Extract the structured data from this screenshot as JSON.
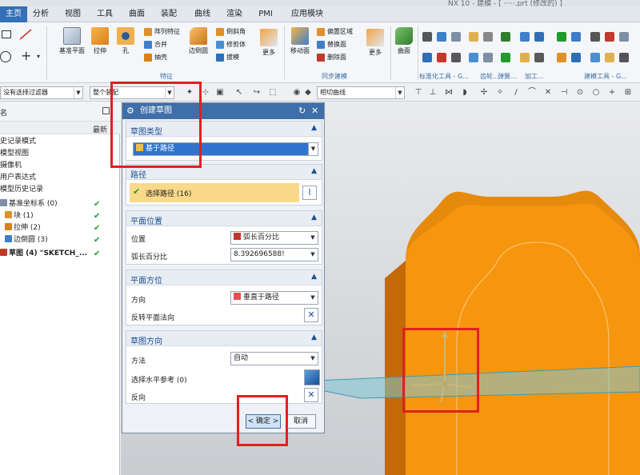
{
  "window": {
    "title_fragment": "NX 10 - 建模 - [ ·····.prt (修改的) ]"
  },
  "menu_tabs": [
    "主页",
    "分析",
    "视图",
    "工具",
    "曲面",
    "装配",
    "曲线",
    "渲染",
    "PMI",
    "应用模块"
  ],
  "ribbon": {
    "big_buttons": {
      "datum_plane": "基准平面",
      "extrude": "拉伸",
      "hole": "孔",
      "edge_blend": "边倒圆",
      "more1": "更多",
      "move_face": "移动面",
      "more2": "更多",
      "surface": "曲面"
    },
    "small_buttons": {
      "pattern_feature": "阵列特征",
      "unite": "合并",
      "shell": "抽壳",
      "chamfer": "倒斜角",
      "trim_body": "修剪体",
      "draft": "拔模",
      "offset_region": "偏置区域",
      "replace_face": "替换面",
      "delete_face": "删除面"
    },
    "groups": {
      "feature": "特征",
      "sync": "同步建模",
      "std_tools": "标准化工具 - G...",
      "gear": "齿轮...",
      "spring": "弹簧...",
      "machining": "加工...",
      "build_tools": "建模工具 - G..."
    }
  },
  "filter_bar": {
    "filter": "没有选择过滤器",
    "scope": "整个装配",
    "curve_rule": "相切曲线"
  },
  "navigator": {
    "header": "名",
    "col_latest": "最新",
    "rows": [
      {
        "label": "史记录模式",
        "check": ""
      },
      {
        "label": "模型视图",
        "check": ""
      },
      {
        "label": "摄像机",
        "check": ""
      },
      {
        "label": "用户表达式",
        "check": ""
      },
      {
        "label": "模型历史记录",
        "check": ""
      },
      {
        "label": "基准坐标系 (0)",
        "check": "✔"
      },
      {
        "label": "块 (1)",
        "check": "✔"
      },
      {
        "label": "拉伸 (2)",
        "check": "✔"
      },
      {
        "label": "边倒圆 (3)",
        "check": "✔"
      },
      {
        "label": "草图 (4) \"SKETCH_...",
        "check": "✔"
      }
    ]
  },
  "dialog": {
    "title": "创建草图",
    "sketch_type": {
      "title": "草图类型",
      "value": "基于路径"
    },
    "path": {
      "title": "路径",
      "select_label": "选择路径 (16)"
    },
    "plane_location": {
      "title": "平面位置",
      "position_label": "位置",
      "position_value": "弧长百分比",
      "arc_pct_label": "弧长百分比",
      "arc_pct_value": "8.392696588!"
    },
    "plane_orientation": {
      "title": "平面方位",
      "direction_label": "方向",
      "direction_value": "垂直于路径",
      "reverse_label": "反转平面法向"
    },
    "sketch_orientation": {
      "title": "草图方向",
      "method_label": "方法",
      "method_value": "自动",
      "horiz_ref_label": "选择水平参考 (0)",
      "reverse_label": "反向"
    },
    "ok": "< 确定 >",
    "cancel": "取消"
  },
  "colors": {
    "accent_blue": "#3470b8",
    "model_orange": "#f5960e",
    "highlight_red": "#e02020",
    "plane_cyan": "#7fc6d6"
  }
}
